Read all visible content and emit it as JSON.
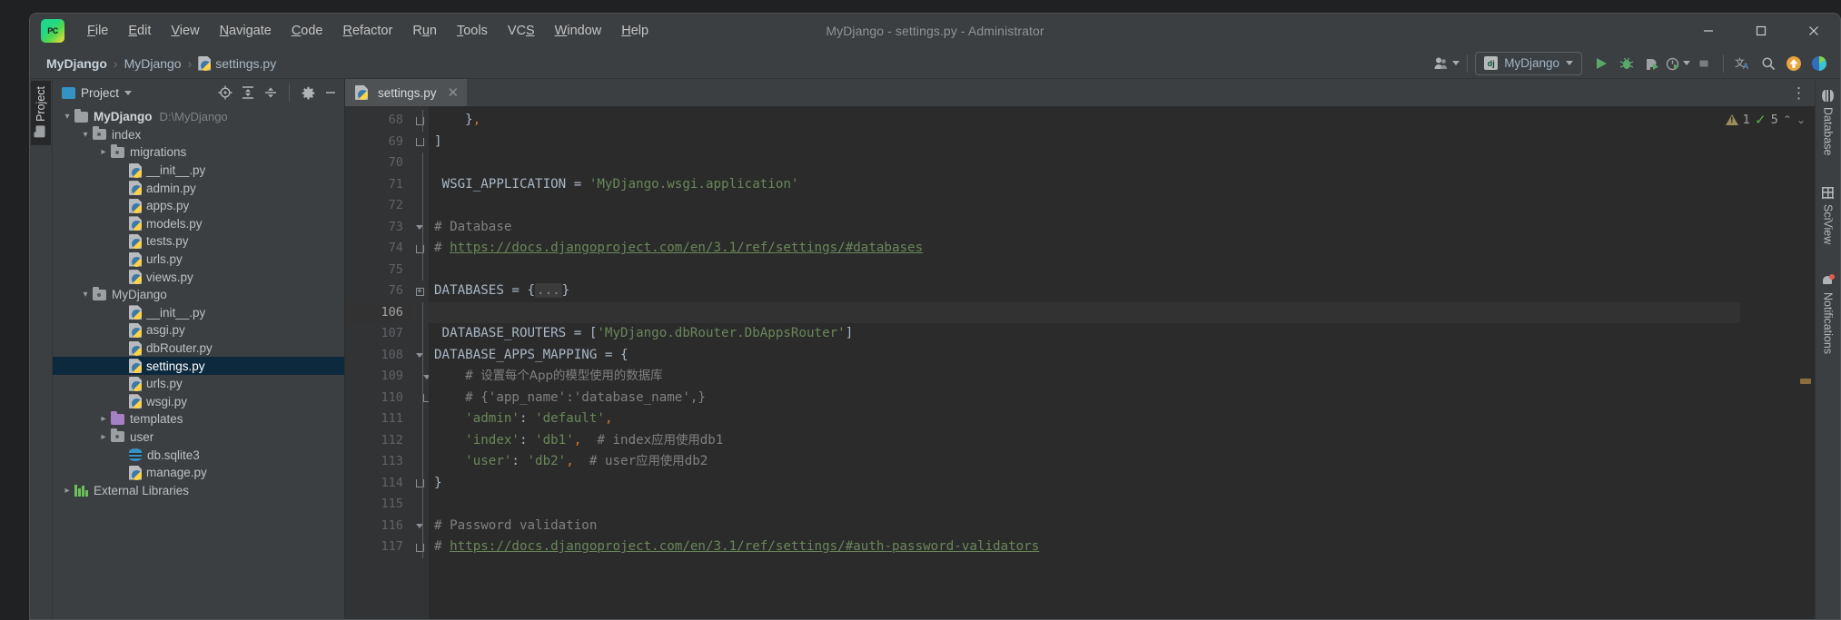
{
  "window": {
    "title": "MyDjango - settings.py - Administrator",
    "minimize": "—",
    "maximize": "☐",
    "close": "✕"
  },
  "menu": {
    "items": [
      {
        "label": "File",
        "mnemonic": "F"
      },
      {
        "label": "Edit",
        "mnemonic": "E"
      },
      {
        "label": "View",
        "mnemonic": "V"
      },
      {
        "label": "Navigate",
        "mnemonic": "N"
      },
      {
        "label": "Code",
        "mnemonic": "C"
      },
      {
        "label": "Refactor",
        "mnemonic": "R"
      },
      {
        "label": "Run",
        "mnemonic": "u"
      },
      {
        "label": "Tools",
        "mnemonic": "T"
      },
      {
        "label": "VCS",
        "mnemonic": "S"
      },
      {
        "label": "Window",
        "mnemonic": "W"
      },
      {
        "label": "Help",
        "mnemonic": "H"
      }
    ]
  },
  "breadcrumb": {
    "items": [
      "MyDjango",
      "MyDjango",
      "settings.py"
    ],
    "separator": "›"
  },
  "toolbar": {
    "run_config": "MyDjango",
    "run_config_icon": "dj",
    "buttons": [
      {
        "name": "user-settings-icon",
        "label": ""
      },
      {
        "name": "run-icon",
        "label": ""
      },
      {
        "name": "debug-icon",
        "label": ""
      },
      {
        "name": "run-with-coverage-icon",
        "label": ""
      },
      {
        "name": "profiler-icon",
        "label": ""
      },
      {
        "name": "stop-icon",
        "label": ""
      },
      {
        "name": "translate-icon",
        "label": ""
      },
      {
        "name": "search-everywhere-icon",
        "label": ""
      },
      {
        "name": "update-icon",
        "label": ""
      },
      {
        "name": "ide-feature-icon",
        "label": ""
      }
    ]
  },
  "left_strip": {
    "project_tab": "Project"
  },
  "project_panel": {
    "title": "Project",
    "tools": [
      "locate-icon",
      "expand-all-icon",
      "collapse-all-icon",
      "settings-icon",
      "hide-icon"
    ],
    "tree": [
      {
        "depth": 0,
        "arrow": "open",
        "icon": "folder",
        "name": "MyDjango",
        "path": "D:\\MyDjango",
        "bold": true,
        "selected": false
      },
      {
        "depth": 1,
        "arrow": "open",
        "icon": "module",
        "name": "index",
        "path": "",
        "bold": false,
        "selected": false
      },
      {
        "depth": 2,
        "arrow": "closed",
        "icon": "module",
        "name": "migrations",
        "path": "",
        "bold": false,
        "selected": false
      },
      {
        "depth": 3,
        "arrow": "none",
        "icon": "python",
        "name": "__init__.py",
        "path": "",
        "bold": false,
        "selected": false
      },
      {
        "depth": 3,
        "arrow": "none",
        "icon": "python",
        "name": "admin.py",
        "path": "",
        "bold": false,
        "selected": false
      },
      {
        "depth": 3,
        "arrow": "none",
        "icon": "python",
        "name": "apps.py",
        "path": "",
        "bold": false,
        "selected": false
      },
      {
        "depth": 3,
        "arrow": "none",
        "icon": "python",
        "name": "models.py",
        "path": "",
        "bold": false,
        "selected": false
      },
      {
        "depth": 3,
        "arrow": "none",
        "icon": "python",
        "name": "tests.py",
        "path": "",
        "bold": false,
        "selected": false
      },
      {
        "depth": 3,
        "arrow": "none",
        "icon": "python",
        "name": "urls.py",
        "path": "",
        "bold": false,
        "selected": false
      },
      {
        "depth": 3,
        "arrow": "none",
        "icon": "python",
        "name": "views.py",
        "path": "",
        "bold": false,
        "selected": false
      },
      {
        "depth": 1,
        "arrow": "open",
        "icon": "module",
        "name": "MyDjango",
        "path": "",
        "bold": false,
        "selected": false
      },
      {
        "depth": 3,
        "arrow": "none",
        "icon": "python",
        "name": "__init__.py",
        "path": "",
        "bold": false,
        "selected": false
      },
      {
        "depth": 3,
        "arrow": "none",
        "icon": "python",
        "name": "asgi.py",
        "path": "",
        "bold": false,
        "selected": false
      },
      {
        "depth": 3,
        "arrow": "none",
        "icon": "python",
        "name": "dbRouter.py",
        "path": "",
        "bold": false,
        "selected": false
      },
      {
        "depth": 3,
        "arrow": "none",
        "icon": "python",
        "name": "settings.py",
        "path": "",
        "bold": false,
        "selected": true
      },
      {
        "depth": 3,
        "arrow": "none",
        "icon": "python",
        "name": "urls.py",
        "path": "",
        "bold": false,
        "selected": false
      },
      {
        "depth": 3,
        "arrow": "none",
        "icon": "python",
        "name": "wsgi.py",
        "path": "",
        "bold": false,
        "selected": false
      },
      {
        "depth": 2,
        "arrow": "closed",
        "icon": "tplfolder",
        "name": "templates",
        "path": "",
        "bold": false,
        "selected": false
      },
      {
        "depth": 2,
        "arrow": "closed",
        "icon": "module",
        "name": "user",
        "path": "",
        "bold": false,
        "selected": false
      },
      {
        "depth": 3,
        "arrow": "none",
        "icon": "sqlite",
        "name": "db.sqlite3",
        "path": "",
        "bold": false,
        "selected": false
      },
      {
        "depth": 3,
        "arrow": "none",
        "icon": "python",
        "name": "manage.py",
        "path": "",
        "bold": false,
        "selected": false
      },
      {
        "depth": 0,
        "arrow": "closed",
        "icon": "library",
        "name": "External Libraries",
        "path": "",
        "bold": false,
        "selected": false
      }
    ]
  },
  "editor": {
    "tab": {
      "label": "settings.py",
      "close": "✕"
    },
    "overflow_menu": "⋮",
    "inspection": {
      "warning_count": "1",
      "ok_count": "5",
      "up": "⌃",
      "down": "⌄"
    },
    "lines": [
      {
        "num": "68",
        "fold": "cap-end",
        "current": false,
        "tokens": [
          {
            "t": "plain",
            "v": "    }"
          },
          {
            "t": "punc",
            "v": ","
          }
        ]
      },
      {
        "num": "69",
        "fold": "cap-end2",
        "current": false,
        "tokens": [
          {
            "t": "plain",
            "v": "]"
          }
        ]
      },
      {
        "num": "70",
        "fold": "line",
        "current": false,
        "tokens": []
      },
      {
        "num": "71",
        "fold": "line",
        "current": false,
        "tokens": [
          {
            "t": "plain",
            "v": " WSGI_APPLICATION = "
          },
          {
            "t": "str",
            "v": "'MyDjango.wsgi.application'"
          }
        ]
      },
      {
        "num": "72",
        "fold": "line",
        "current": false,
        "tokens": []
      },
      {
        "num": "73",
        "fold": "arrow",
        "current": false,
        "tokens": [
          {
            "t": "cmt",
            "v": "# Database"
          }
        ]
      },
      {
        "num": "74",
        "fold": "cap-end",
        "current": false,
        "tokens": [
          {
            "t": "cmt",
            "v": "# "
          },
          {
            "t": "lnk",
            "v": "https://docs.djangoproject.com/en/3.1/ref/settings/#databases"
          }
        ]
      },
      {
        "num": "75",
        "fold": "line",
        "current": false,
        "tokens": []
      },
      {
        "num": "76",
        "fold": "plus",
        "current": false,
        "tokens": [
          {
            "t": "plain",
            "v": "DATABASES = {"
          },
          {
            "t": "folded",
            "v": "..."
          },
          {
            "t": "plain",
            "v": "}"
          }
        ]
      },
      {
        "num": "106",
        "fold": "line",
        "current": true,
        "tokens": []
      },
      {
        "num": "107",
        "fold": "line",
        "current": false,
        "tokens": [
          {
            "t": "plain",
            "v": " DATABASE_ROUTERS = ["
          },
          {
            "t": "str",
            "v": "'MyDjango.dbRouter.DbAppsRouter'"
          },
          {
            "t": "plain",
            "v": "]"
          }
        ]
      },
      {
        "num": "108",
        "fold": "arrow",
        "current": false,
        "tokens": [
          {
            "t": "plain",
            "v": "DATABASE_APPS_MAPPING = {"
          }
        ]
      },
      {
        "num": "109",
        "fold": "arrow-in",
        "current": false,
        "tokens": [
          {
            "t": "cmt",
            "v": "    # "
          },
          {
            "t": "cmt-zh",
            "v": "设置每个App的模型使用的数据库"
          }
        ]
      },
      {
        "num": "110",
        "fold": "cap-in",
        "current": false,
        "tokens": [
          {
            "t": "cmt",
            "v": "    # {'app_name':'database_name',}"
          }
        ]
      },
      {
        "num": "111",
        "fold": "line",
        "current": false,
        "tokens": [
          {
            "t": "str",
            "v": "    'admin'"
          },
          {
            "t": "plain",
            "v": ": "
          },
          {
            "t": "str",
            "v": "'default'"
          },
          {
            "t": "punc",
            "v": ","
          }
        ]
      },
      {
        "num": "112",
        "fold": "line",
        "current": false,
        "tokens": [
          {
            "t": "str",
            "v": "    'index'"
          },
          {
            "t": "plain",
            "v": ": "
          },
          {
            "t": "str",
            "v": "'db1'"
          },
          {
            "t": "punc",
            "v": ","
          },
          {
            "t": "cmt",
            "v": "  # index"
          },
          {
            "t": "cmt-zh",
            "v": "应用使用"
          },
          {
            "t": "cmt",
            "v": "db1"
          }
        ]
      },
      {
        "num": "113",
        "fold": "line",
        "current": false,
        "tokens": [
          {
            "t": "str",
            "v": "    'user'"
          },
          {
            "t": "plain",
            "v": ": "
          },
          {
            "t": "str",
            "v": "'db2'"
          },
          {
            "t": "punc",
            "v": ","
          },
          {
            "t": "cmt",
            "v": "  # user"
          },
          {
            "t": "cmt-zh",
            "v": "应用使用"
          },
          {
            "t": "cmt",
            "v": "db2"
          }
        ]
      },
      {
        "num": "114",
        "fold": "cap-end",
        "current": false,
        "tokens": [
          {
            "t": "plain",
            "v": "}"
          }
        ]
      },
      {
        "num": "115",
        "fold": "line",
        "current": false,
        "tokens": []
      },
      {
        "num": "116",
        "fold": "arrow",
        "current": false,
        "tokens": [
          {
            "t": "cmt",
            "v": "# Password validation"
          }
        ]
      },
      {
        "num": "117",
        "fold": "cap-end",
        "current": false,
        "tokens": [
          {
            "t": "cmt",
            "v": "# "
          },
          {
            "t": "lnk",
            "v": "https://docs.djangoproject.com/en/3.1/ref/settings/#auth-password-validators"
          }
        ]
      }
    ]
  },
  "right_strip": {
    "tabs": [
      {
        "label": "Database",
        "icon": "database-icon",
        "badge": false
      },
      {
        "label": "SciView",
        "icon": "grid-icon",
        "badge": false
      },
      {
        "label": "Notifications",
        "icon": "bell-icon",
        "badge": true
      }
    ]
  },
  "colors": {
    "accent_blue": "#3592c4",
    "selection": "#0d293e",
    "string_green": "#6a8759",
    "comment_gray": "#808080",
    "keyword_orange": "#cc7832",
    "run_green": "#5fae48"
  }
}
